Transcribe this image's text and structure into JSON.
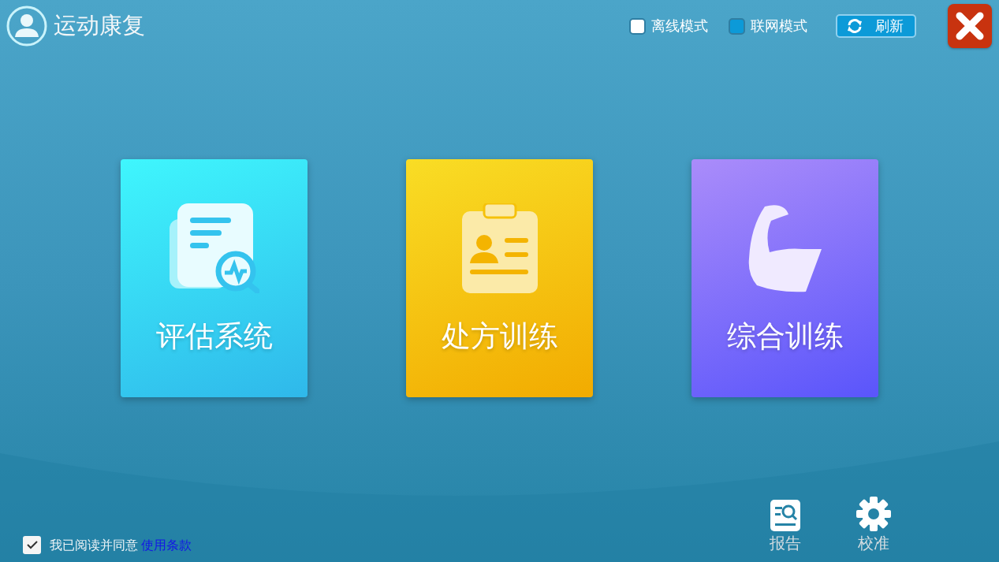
{
  "header": {
    "title": "运动康复"
  },
  "modes": [
    {
      "label": "离线模式",
      "checked": false
    },
    {
      "label": "联网模式",
      "checked": true
    }
  ],
  "refresh_button": {
    "label": "刷新"
  },
  "cards": [
    {
      "kind": "assess",
      "label": "评估系统"
    },
    {
      "kind": "prescription",
      "label": "处方训练"
    },
    {
      "kind": "training",
      "label": "综合训练"
    }
  ],
  "agreement": {
    "checked": true,
    "text": "我已阅读并同意",
    "link": "使用条款"
  },
  "tools": [
    {
      "kind": "report",
      "label": "报告"
    },
    {
      "kind": "calibrate",
      "label": "校准"
    }
  ]
}
